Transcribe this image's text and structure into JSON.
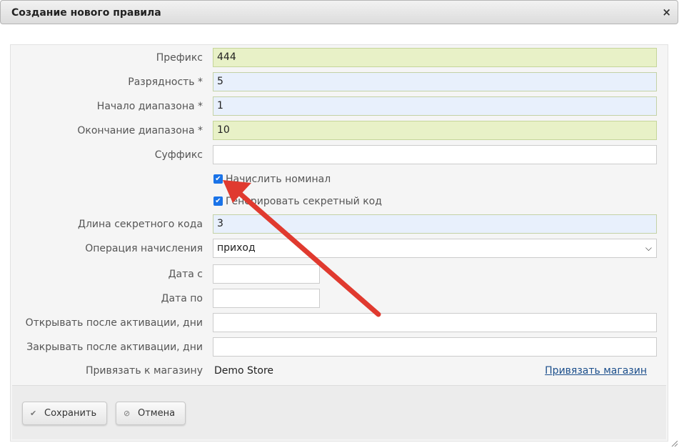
{
  "dialog": {
    "title": "Создание нового правила",
    "close_glyph": "×"
  },
  "form": {
    "prefix": {
      "label": "Префикс",
      "value": "444"
    },
    "digits": {
      "label": "Разрядность *",
      "value": "5"
    },
    "range_start": {
      "label": "Начало диапазона *",
      "value": "1"
    },
    "range_end": {
      "label": "Окончание диапазона *",
      "value": "10"
    },
    "suffix": {
      "label": "Суффикс",
      "value": ""
    },
    "charge_nominal": {
      "label": "Начислить номинал",
      "checked": true
    },
    "generate_secret": {
      "label": "Генерировать секретный код",
      "checked": true
    },
    "secret_length": {
      "label": "Длина секретного кода",
      "value": "3"
    },
    "operation": {
      "label": "Операция начисления",
      "selected": "приход"
    },
    "date_from": {
      "label": "Дата с",
      "value": ""
    },
    "date_to": {
      "label": "Дата по",
      "value": ""
    },
    "open_after": {
      "label": "Открывать после активации, дни",
      "value": ""
    },
    "close_after": {
      "label": "Закрывать после активации, дни",
      "value": ""
    },
    "store": {
      "label": "Привязать к магазину",
      "value": "Demo Store",
      "link": "Привязать магазин"
    }
  },
  "footer": {
    "save_label": "Сохранить",
    "cancel_label": "Отмена"
  },
  "icons": {
    "save": "check-icon",
    "cancel": "cancel-icon"
  },
  "colors": {
    "accent": "#1a73e8",
    "annotation_arrow": "#e03a2f",
    "link": "#1c4f8c"
  }
}
